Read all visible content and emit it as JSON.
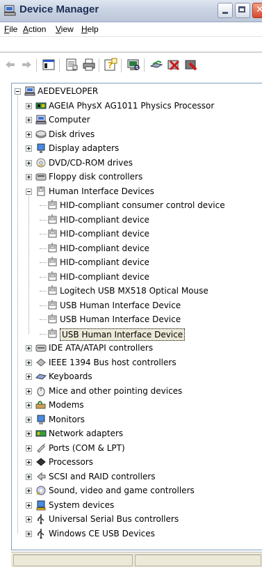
{
  "window": {
    "title": "Device Manager"
  },
  "menu": [
    {
      "label": "File",
      "accel": "F",
      "rest": "ile"
    },
    {
      "label": "Action",
      "accel": "A",
      "rest": "ction"
    },
    {
      "label": "View",
      "accel": "V",
      "rest": "iew"
    },
    {
      "label": "Help",
      "accel": "H",
      "rest": "elp"
    }
  ],
  "toolbar": [
    "back-icon",
    "forward-icon",
    "show-hide-tree-icon",
    "properties-icon",
    "print-icon",
    "help-icon",
    "scan-hardware-icon",
    "update-driver-icon",
    "uninstall-icon",
    "disable-icon"
  ],
  "tree": {
    "root": "AEDEVELOPER",
    "categories": [
      {
        "label": "AGEIA PhysX AG1011 Physics Processor",
        "icon": "physx-card-icon"
      },
      {
        "label": "Computer",
        "icon": "computer-icon"
      },
      {
        "label": "Disk drives",
        "icon": "disk-drive-icon"
      },
      {
        "label": "Display adapters",
        "icon": "display-adapter-icon"
      },
      {
        "label": "DVD/CD-ROM drives",
        "icon": "dvd-drive-icon"
      },
      {
        "label": "Floppy disk controllers",
        "icon": "floppy-controller-icon"
      },
      {
        "label": "Human Interface Devices",
        "icon": "hid-icon",
        "expanded": true,
        "children": [
          "HID-compliant consumer control device",
          "HID-compliant device",
          "HID-compliant device",
          "HID-compliant device",
          "HID-compliant device",
          "HID-compliant device",
          "Logitech USB MX518 Optical Mouse",
          "USB Human Interface Device",
          "USB Human Interface Device",
          "USB Human Interface Device"
        ],
        "selected_child": 9
      },
      {
        "label": "IDE ATA/ATAPI controllers",
        "icon": "ide-controller-icon"
      },
      {
        "label": "IEEE 1394 Bus host controllers",
        "icon": "ieee1394-icon"
      },
      {
        "label": "Keyboards",
        "icon": "keyboard-icon"
      },
      {
        "label": "Mice and other pointing devices",
        "icon": "mouse-icon"
      },
      {
        "label": "Modems",
        "icon": "modem-icon"
      },
      {
        "label": "Monitors",
        "icon": "monitor-icon"
      },
      {
        "label": "Network adapters",
        "icon": "network-adapter-icon"
      },
      {
        "label": "Ports (COM & LPT)",
        "icon": "port-icon"
      },
      {
        "label": "Processors",
        "icon": "processor-icon"
      },
      {
        "label": "SCSI and RAID controllers",
        "icon": "scsi-icon"
      },
      {
        "label": "Sound, video and game controllers",
        "icon": "sound-icon"
      },
      {
        "label": "System devices",
        "icon": "system-devices-icon"
      },
      {
        "label": "Universal Serial Bus controllers",
        "icon": "usb-controller-icon"
      },
      {
        "label": "Windows CE USB Devices",
        "icon": "windows-ce-usb-icon"
      }
    ]
  }
}
